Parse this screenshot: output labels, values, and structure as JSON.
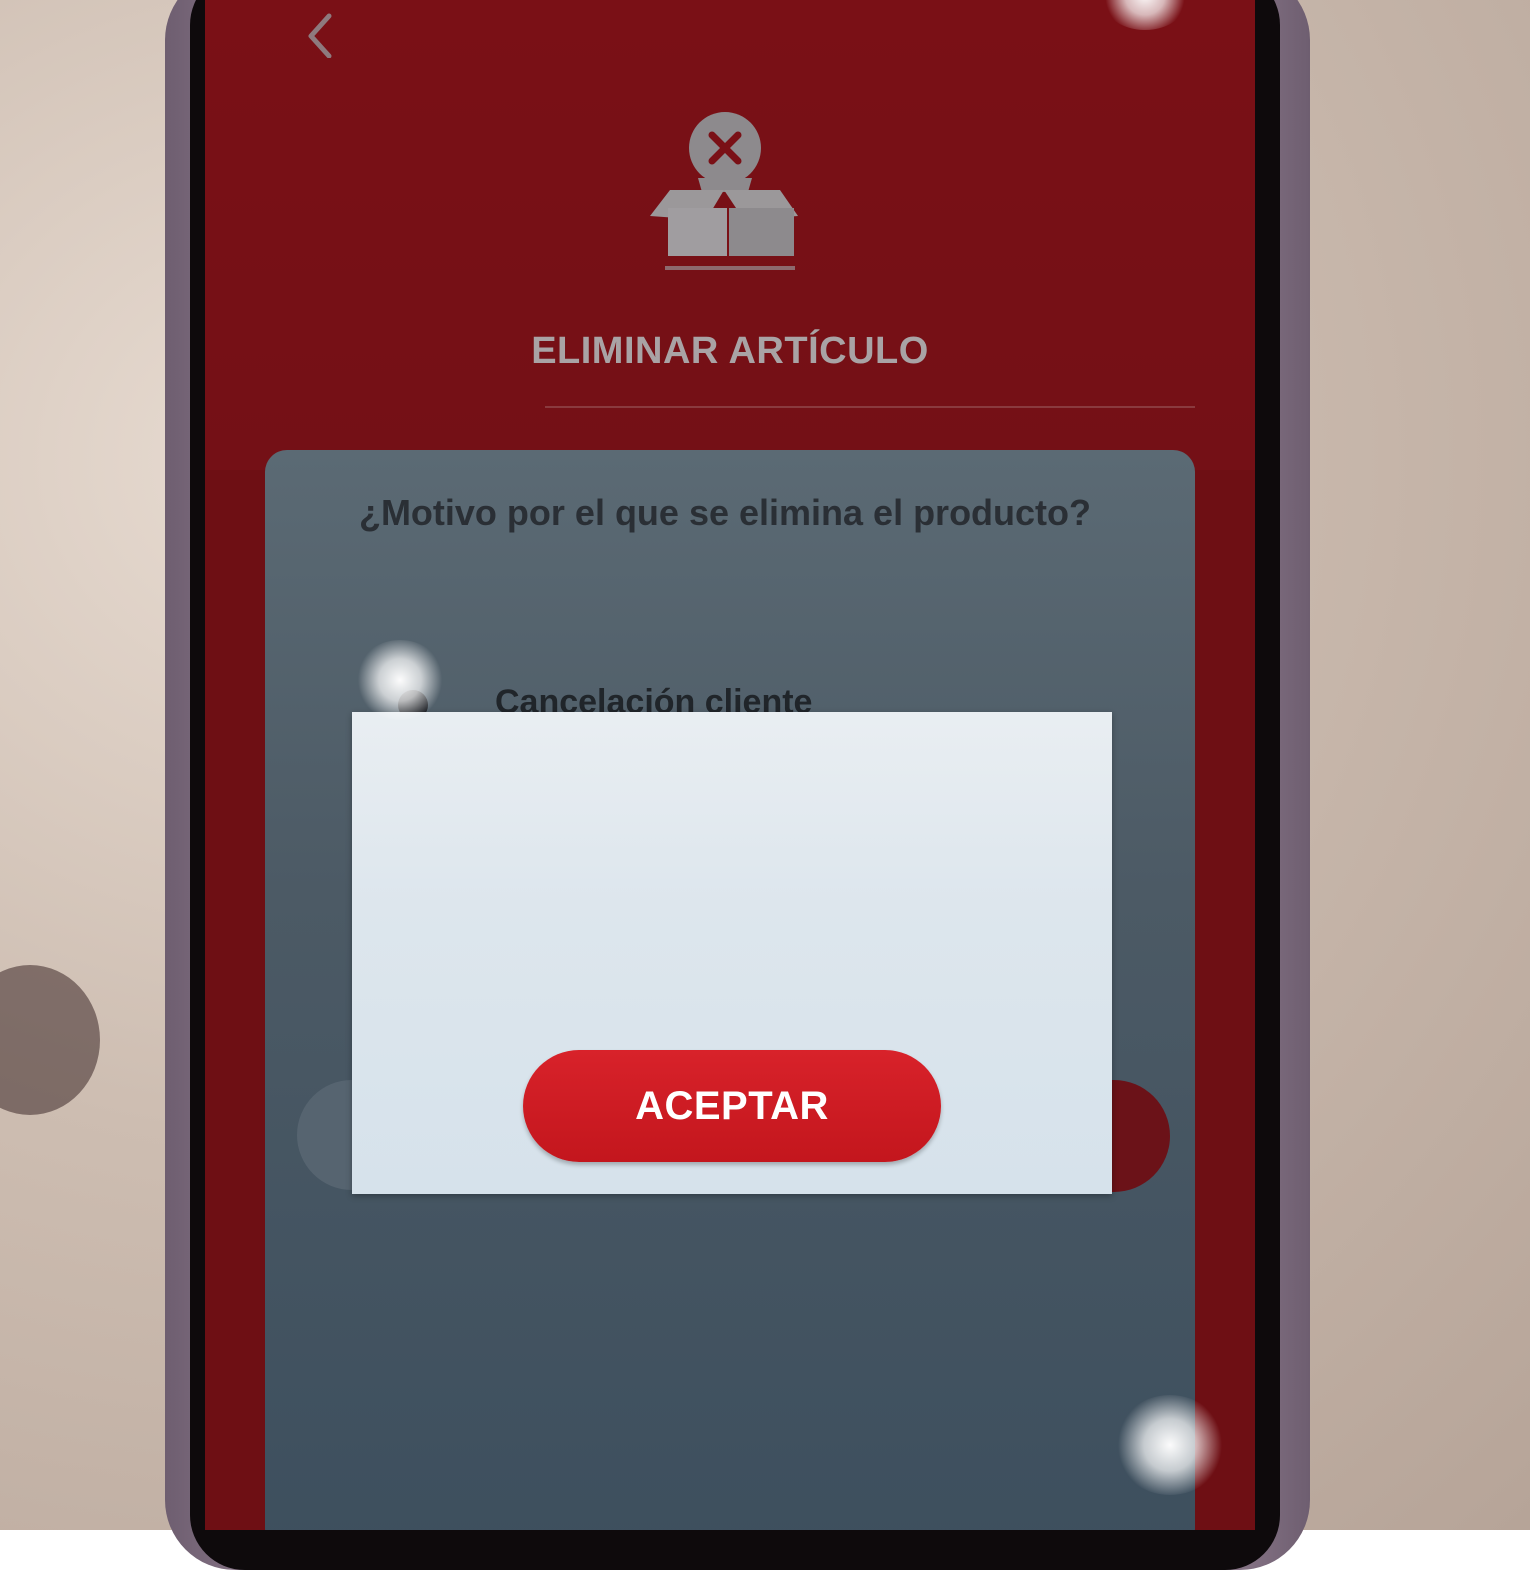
{
  "screen": {
    "title": "ELIMINAR ARTÍCULO",
    "back_icon": "chevron-left-icon",
    "header_icon": "box-remove-icon"
  },
  "question": {
    "text": "¿Motivo por el que se elimina el producto?"
  },
  "options": [
    {
      "label": "Cancelación cliente",
      "selected": true
    }
  ],
  "dialog": {
    "message": "",
    "accept_label": "ACEPTAR"
  },
  "colors": {
    "header_background": "#7a1016",
    "overlay": "#4c5a65",
    "dialog_background": "#dde6ed",
    "accent_red": "#c3161d",
    "button_text": "#ffffff"
  }
}
